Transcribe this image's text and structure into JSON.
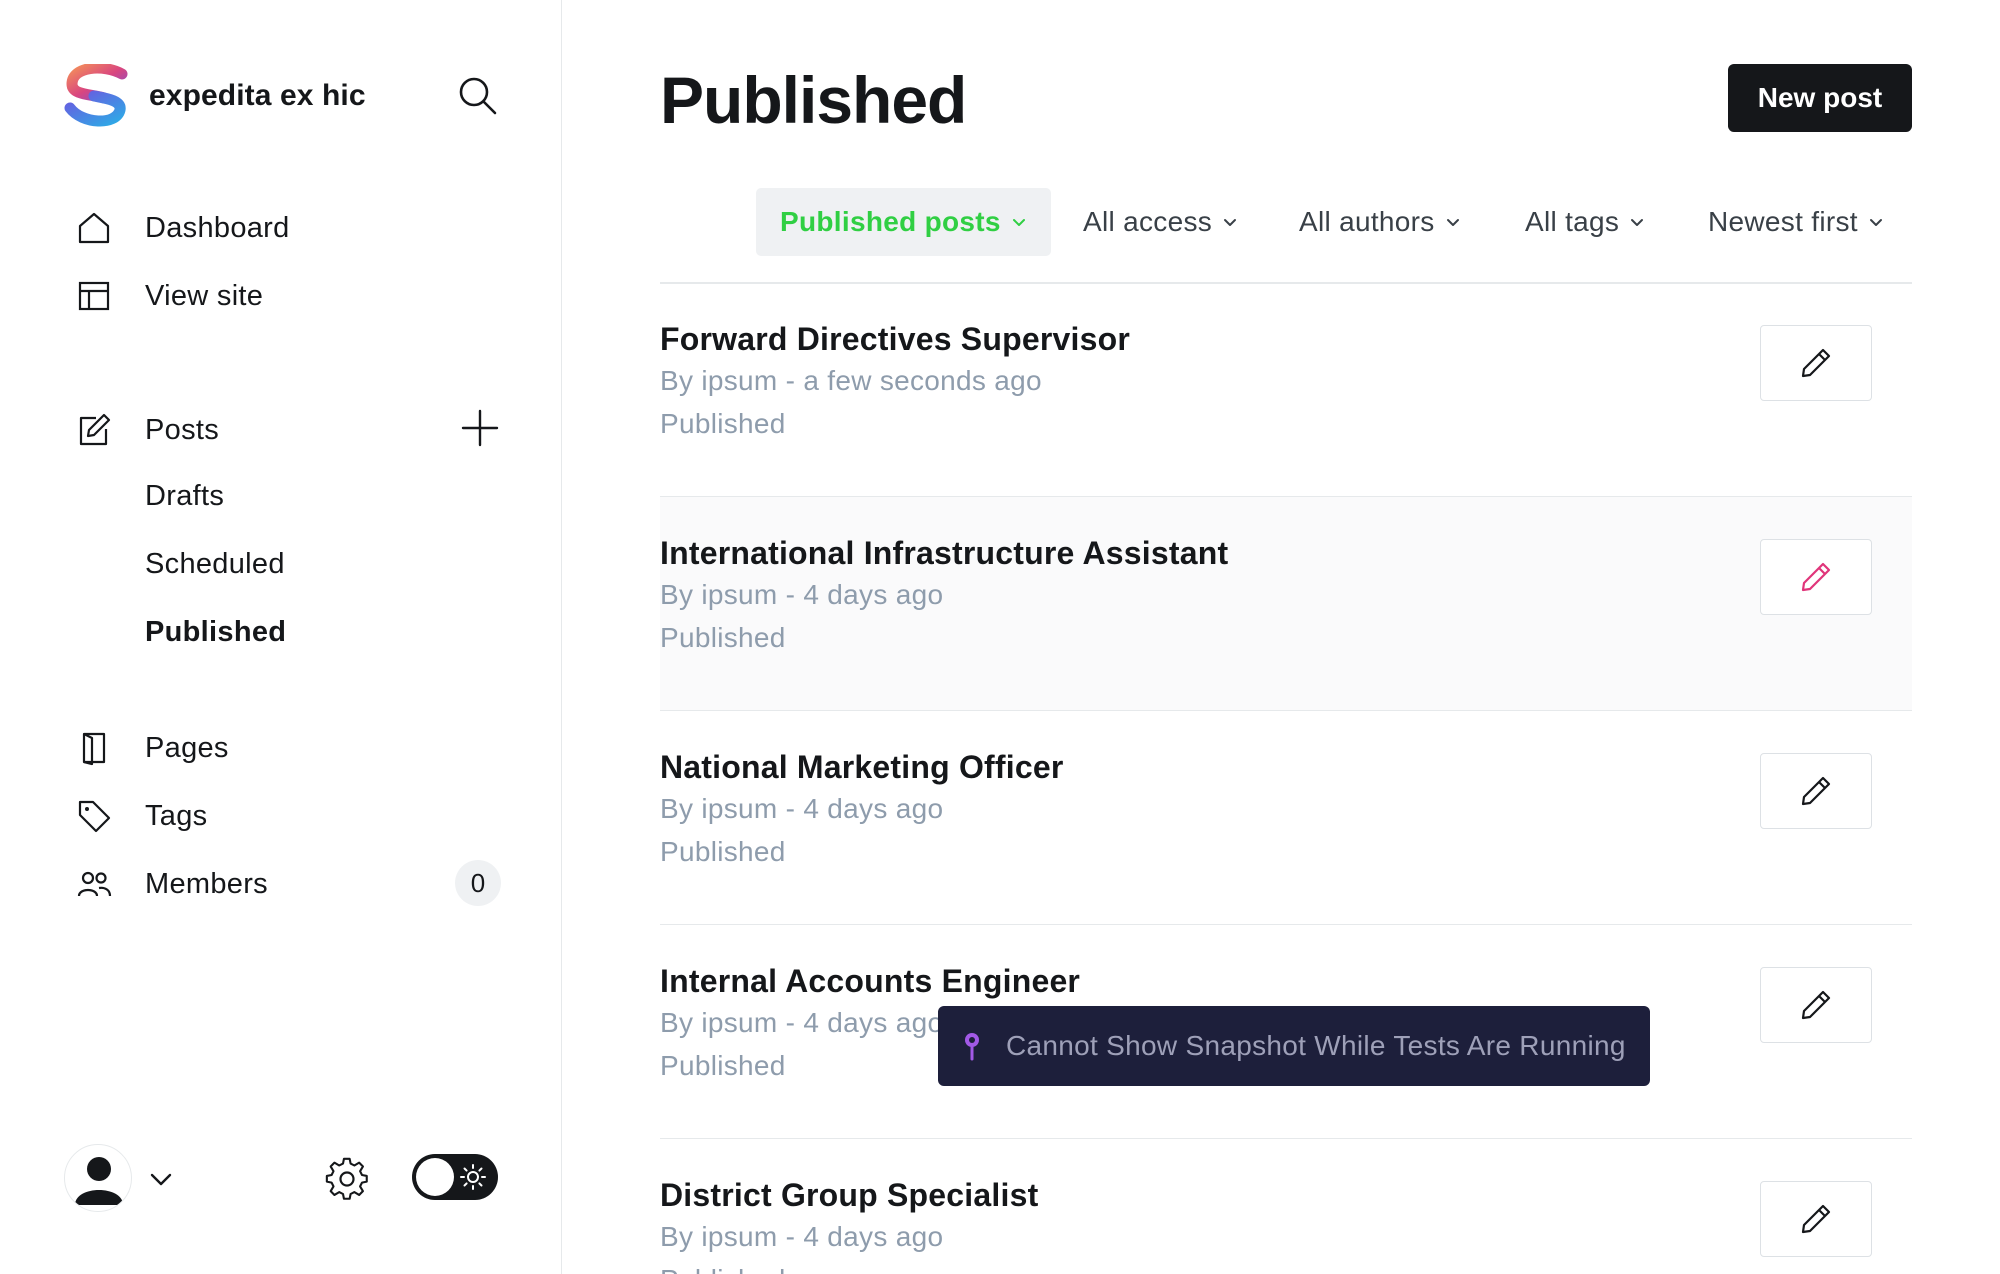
{
  "brand": {
    "name": "expedita ex hic"
  },
  "nav": {
    "dashboard": "Dashboard",
    "view_site": "View site",
    "posts": "Posts",
    "drafts": "Drafts",
    "scheduled": "Scheduled",
    "published": "Published",
    "pages": "Pages",
    "tags": "Tags",
    "members": "Members",
    "members_count": "0"
  },
  "header": {
    "title": "Published",
    "new_post_label": "New post"
  },
  "filters": {
    "type": "Published posts",
    "access": "All access",
    "authors": "All authors",
    "tags": "All tags",
    "order": "Newest first"
  },
  "posts": [
    {
      "title": "Forward Directives Supervisor",
      "meta": "By ipsum - a few seconds ago",
      "status": "Published"
    },
    {
      "title": "International Infrastructure Assistant",
      "meta": "By ipsum - 4 days ago",
      "status": "Published"
    },
    {
      "title": "National Marketing Officer",
      "meta": "By ipsum - 4 days ago",
      "status": "Published"
    },
    {
      "title": "Internal Accounts Engineer",
      "meta": "By ipsum - 4 days ago",
      "status": "Published"
    },
    {
      "title": "District Group Specialist",
      "meta": "By ipsum - 4 days ago",
      "status": "Published"
    }
  ],
  "toast": {
    "message": "Cannot Show Snapshot While Tests Are Running"
  },
  "colors": {
    "accent_green": "#30cf43",
    "hover_pink": "#e0357a",
    "dark": "#15171a",
    "muted": "#8e9cac",
    "toast_bg": "#1d1f3b",
    "toast_pin": "#a259e6"
  },
  "icons": [
    "logo",
    "search-icon",
    "home-icon",
    "layout-icon",
    "edit-icon",
    "plus-icon",
    "page-icon",
    "tag-icon",
    "members-icon",
    "user-icon",
    "chevron-down-icon",
    "gear-icon",
    "sun-icon",
    "pencil-icon",
    "pin-icon"
  ]
}
